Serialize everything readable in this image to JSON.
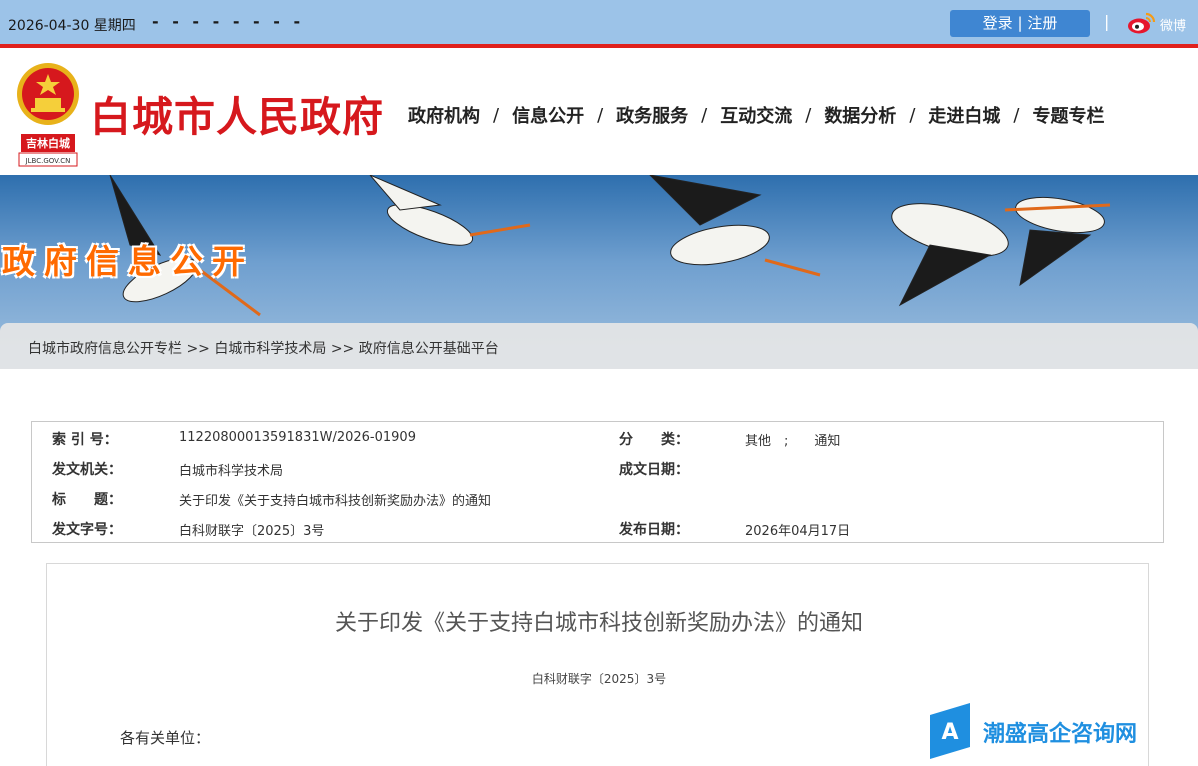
{
  "topbar": {
    "date": "2026-04-30 星期四",
    "dashes": "- - - -   - - - -",
    "login": "登录",
    "register": "注册",
    "separator": "|",
    "weibo": "微博"
  },
  "header": {
    "emblem_label": "吉林白城",
    "emblem_domain": "JLBC.GOV.CN",
    "title": "白城市人民政府",
    "nav": [
      "政府机构",
      "信息公开",
      "政务服务",
      "互动交流",
      "数据分析",
      "走进白城",
      "专题专栏"
    ],
    "nav_separator": "/"
  },
  "banner": {
    "title": "政府信息公开"
  },
  "breadcrumb": {
    "items": [
      "白城市政府信息公开专栏",
      "白城市科学技术局",
      "政府信息公开基础平台"
    ],
    "separator": ">>"
  },
  "meta": {
    "index_label": "索 引 号：",
    "index_value": "11220800013591831W/2026-01909",
    "category_label": "分　　类：",
    "category_value": "其他　;　　通知",
    "issuer_label": "发文机关：",
    "issuer_value": "白城市科学技术局",
    "created_label": "成文日期：",
    "created_value": "",
    "subject_label": "标　　题：",
    "subject_value": "关于印发《关于支持白城市科技创新奖励办法》的通知",
    "docno_label": "发文字号：",
    "docno_value": "白科财联字〔2025〕3号",
    "published_label": "发布日期：",
    "published_value": "2026年04月17日"
  },
  "document": {
    "title": "关于印发《关于支持白城市科技创新奖励办法》的通知",
    "number": "白科财联字〔2025〕3号",
    "greeting": "各有关单位："
  },
  "watermark": {
    "text": "潮盛高企咨询网"
  },
  "colors": {
    "topbar": "#9cc3e8",
    "accent_red": "#d6181d",
    "banner_title": "#ff6a00",
    "login_button": "#3f86d2",
    "watermark": "#1f8fe0"
  }
}
